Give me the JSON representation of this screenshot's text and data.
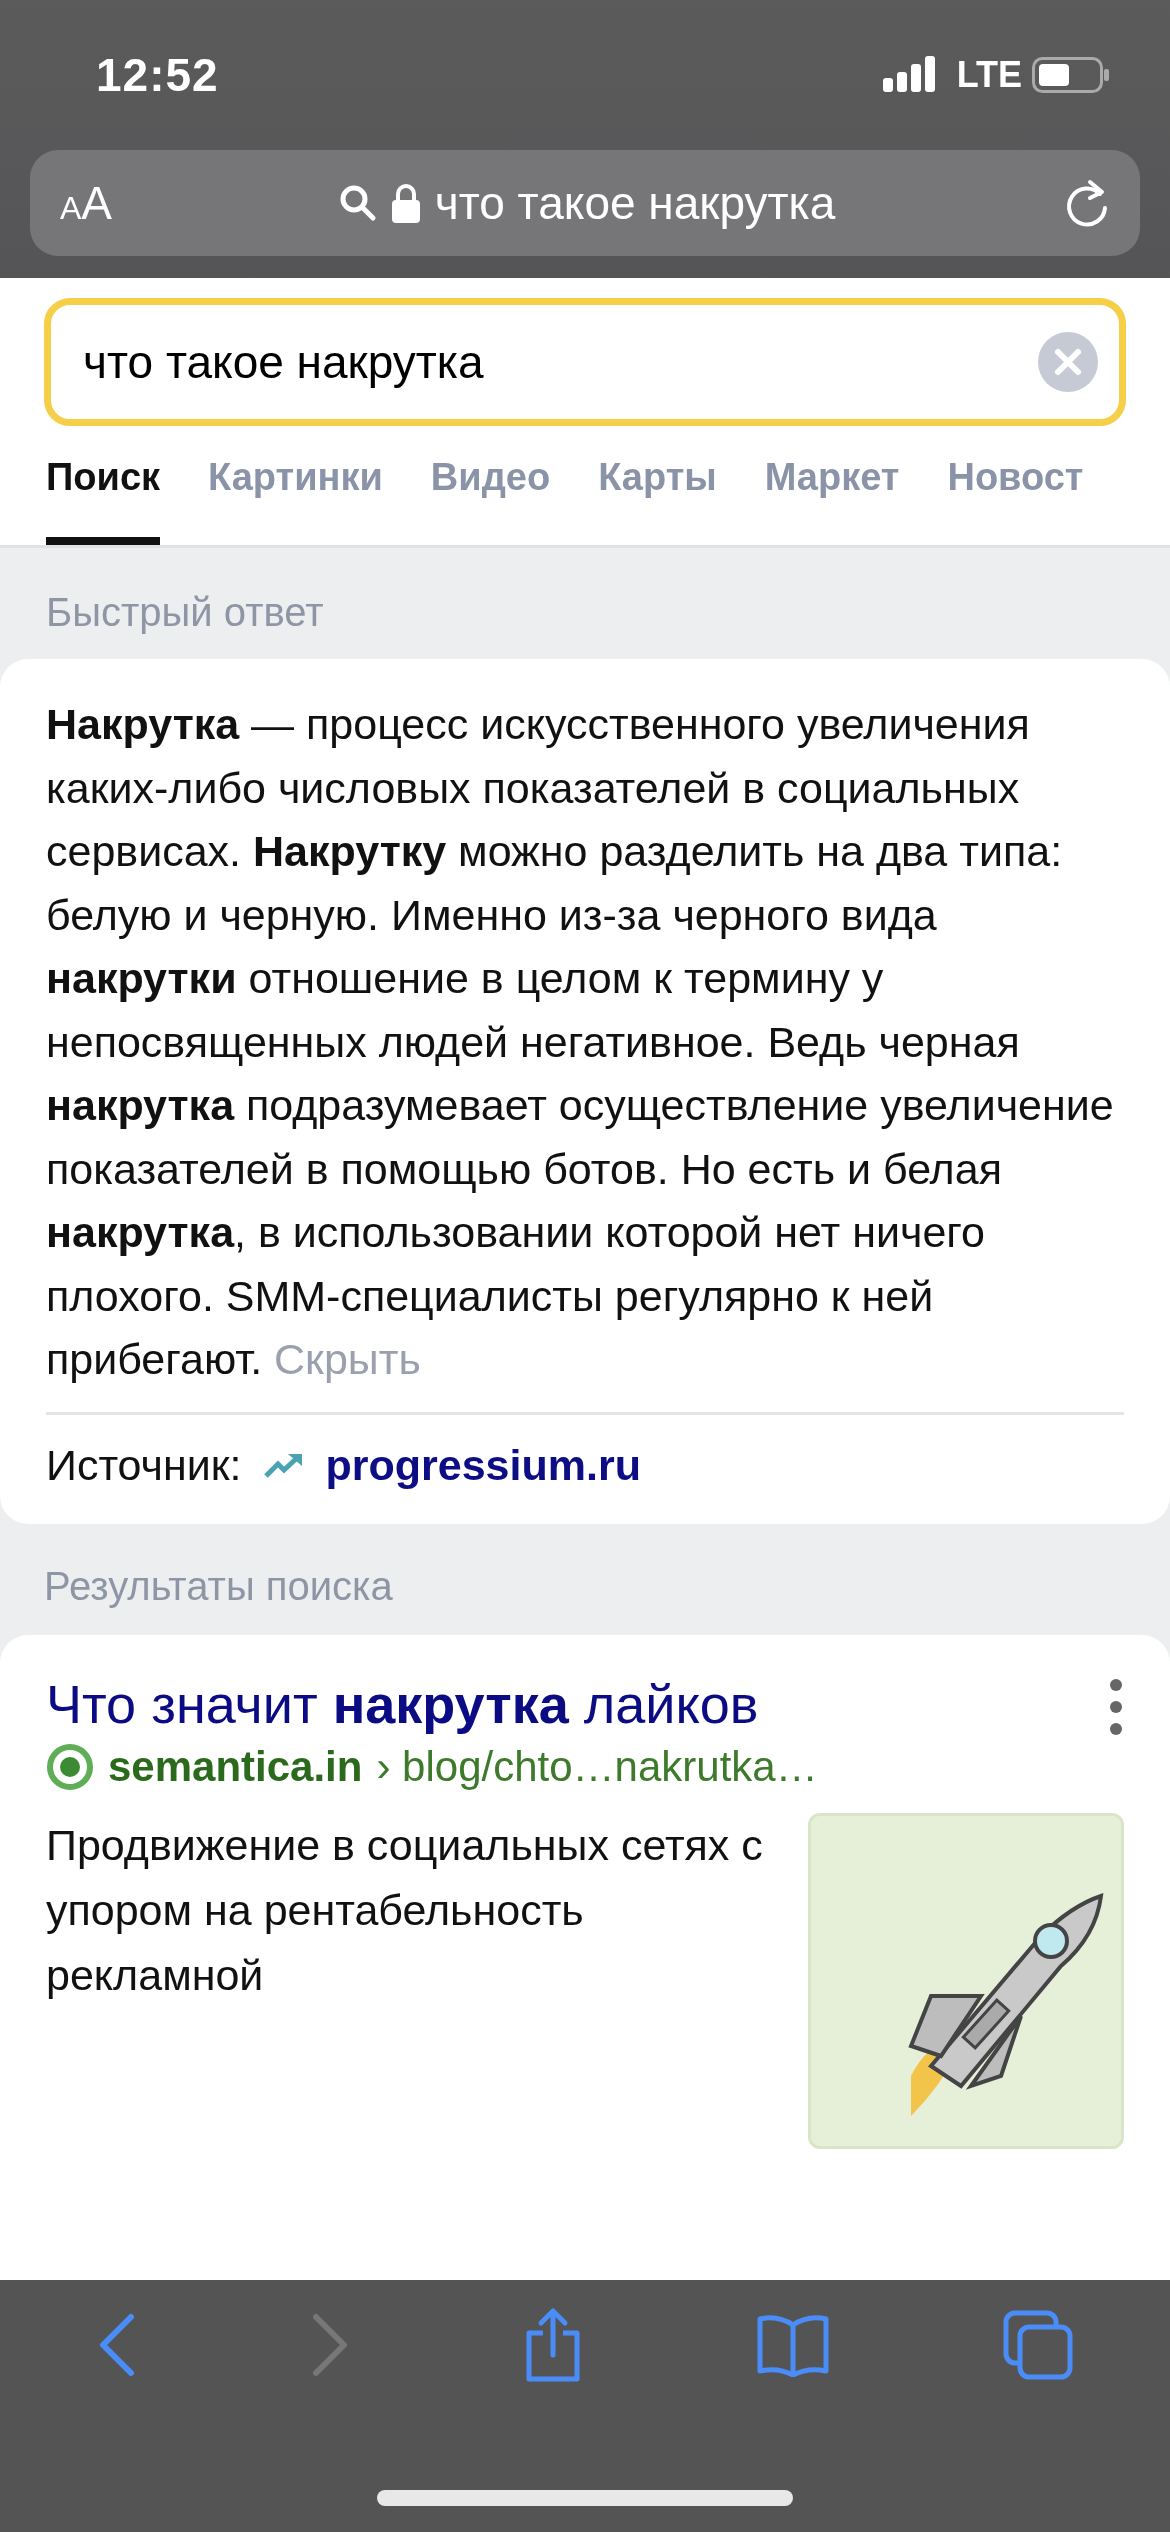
{
  "status_bar": {
    "time": "12:52",
    "network": "LTE"
  },
  "address_bar": {
    "text_size_label": "AA",
    "url": "что такое накрутка"
  },
  "search": {
    "value": "что такое накрутка"
  },
  "tabs": [
    {
      "label": "Поиск",
      "selected": true
    },
    {
      "label": "Картинки",
      "selected": false
    },
    {
      "label": "Видео",
      "selected": false
    },
    {
      "label": "Карты",
      "selected": false
    },
    {
      "label": "Маркет",
      "selected": false
    },
    {
      "label": "Новост",
      "selected": false
    }
  ],
  "quick_answer": {
    "heading": "Быстрый ответ",
    "text": "**Накрутка** — процесс искусственного увеличения каких-либо числовых показателей в социальных сервисах. **Накрутку** можно разделить на два типа: белую и черную. Именно из-за черного вида **накрутки** отношение в целом к термину у непосвященных людей негативное. Ведь черная **накрутка** подразумевает осуществление увеличение показателей в помощью ботов. Но есть и белая **накрутка**, в использовании которой нет ничего плохого. SMM-специалисты регулярно к ней прибегают.",
    "hide_link": "Скрыть",
    "source_label": "Источник:",
    "source": "progressium.ru"
  },
  "results": {
    "heading": "Результаты поиска",
    "items": [
      {
        "title": "Что значит **накрутка** лайков",
        "domain": "semantica.in",
        "path": "› blog/chto…nakrutka…",
        "snippet": "Продвижение в социальных сетях с упором на рентабельность рекламной"
      }
    ]
  },
  "toolbar": [
    {
      "kind": "back",
      "disabled": false
    },
    {
      "kind": "forward",
      "disabled": true
    },
    {
      "kind": "share",
      "disabled": false
    },
    {
      "kind": "bookmarks",
      "disabled": false
    },
    {
      "kind": "tabs",
      "disabled": false
    }
  ]
}
